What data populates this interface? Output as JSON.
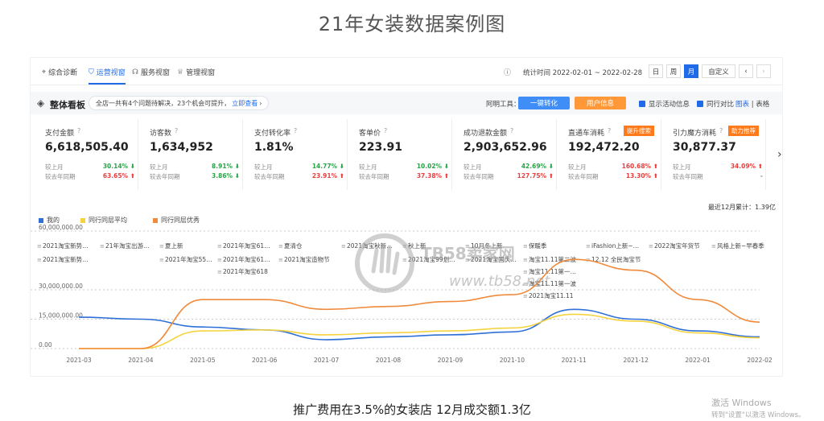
{
  "page_title": "21年女装数据案例图",
  "caption": "推广费用在3.5%的女装店 12月成交额1.3亿",
  "windows_activation": {
    "line1": "激活 Windows",
    "line2": "转到\"设置\"以激活 Windows。"
  },
  "watermark": {
    "text": "TB58卖家网",
    "url": "www.tb58.net"
  },
  "tabs": [
    {
      "label": "综合诊断",
      "icon": "location-icon",
      "active": false
    },
    {
      "label": "运营视窗",
      "icon": "shield-icon",
      "active": true
    },
    {
      "label": "服务视窗",
      "icon": "headset-icon",
      "active": false
    },
    {
      "label": "管理视窗",
      "icon": "trophy-icon",
      "active": false
    }
  ],
  "stat_time": "统计时间 2022-02-01 ~ 2022-02-28",
  "period_buttons": [
    {
      "label": "日",
      "selected": false
    },
    {
      "label": "周",
      "selected": false
    },
    {
      "label": "月",
      "selected": true
    },
    {
      "label": "自定义",
      "selected": false
    }
  ],
  "board": {
    "title": "整体看板",
    "notice": "全店一共有4个问题待解决，23个机会可提升，",
    "notice_link": "立即查看",
    "tool_label": "阿明工具：",
    "btn_convert": "一键转化",
    "btn_user": "用户信息",
    "chk_activity": "显示活动信息",
    "chk_peer": "同行对比",
    "view_chart": "图表",
    "view_table": "表格"
  },
  "kpis": [
    {
      "name": "支付金额",
      "value": "6,618,505.40",
      "r1_label": "较上月",
      "r1_pct": "30.14%",
      "r1_dir": "down",
      "r2_label": "较去年同期",
      "r2_pct": "63.65%",
      "r2_dir": "up",
      "tag": ""
    },
    {
      "name": "访客数",
      "value": "1,634,952",
      "r1_label": "较上月",
      "r1_pct": "8.91%",
      "r1_dir": "down",
      "r2_label": "较去年同期",
      "r2_pct": "3.86%",
      "r2_dir": "down",
      "tag": ""
    },
    {
      "name": "支付转化率",
      "value": "1.81%",
      "r1_label": "较上月",
      "r1_pct": "14.77%",
      "r1_dir": "down",
      "r2_label": "较去年同期",
      "r2_pct": "23.91%",
      "r2_dir": "up",
      "tag": ""
    },
    {
      "name": "客单价",
      "value": "223.91",
      "r1_label": "较上月",
      "r1_pct": "10.02%",
      "r1_dir": "down",
      "r2_label": "较去年同期",
      "r2_pct": "37.38%",
      "r2_dir": "up",
      "tag": ""
    },
    {
      "name": "成功退款金额",
      "value": "2,903,652.96",
      "r1_label": "较上月",
      "r1_pct": "42.69%",
      "r1_dir": "down",
      "r2_label": "较去年同期",
      "r2_pct": "127.75%",
      "r2_dir": "up",
      "tag": ""
    },
    {
      "name": "直通车消耗",
      "value": "192,472.20",
      "r1_label": "较上月",
      "r1_pct": "160.68%",
      "r1_dir": "up",
      "r2_label": "较去年同期",
      "r2_pct": "13.30%",
      "r2_dir": "up",
      "tag": "提升搜索"
    },
    {
      "name": "引力魔方消耗",
      "value": "30,877.37",
      "r1_label": "较上月",
      "r1_pct": "34.09%",
      "r1_dir": "up",
      "r2_label": "较去年同期",
      "r2_pct": "-",
      "r2_dir": "none",
      "tag": "助力推荐"
    }
  ],
  "total_label": "最近12月累计：1.39亿",
  "colors": {
    "mine": "#2f6fd8",
    "peer_avg": "#f5d33f",
    "peer_excellent": "#f08a3c",
    "accent": "#1f6be8"
  },
  "chart_data": {
    "type": "line",
    "x": [
      "2021-03",
      "2021-04",
      "2021-05",
      "2021-06",
      "2021-07",
      "2021-08",
      "2021-09",
      "2021-10",
      "2021-11",
      "2021-12",
      "2022-01",
      "2022-02"
    ],
    "ylim": [
      0,
      60000000
    ],
    "yticks": [
      "0.00",
      "15,000,000.00",
      "30,000,000.00",
      "60,000,000.00"
    ],
    "ytick_values": [
      0,
      15000000,
      30000000,
      60000000
    ],
    "series": [
      {
        "name": "我的",
        "color": "#2f6fd8",
        "values": [
          16000000,
          15000000,
          11000000,
          9500000,
          4500000,
          6000000,
          7000000,
          8500000,
          20000000,
          15000000,
          9000000,
          6000000
        ]
      },
      {
        "name": "同行同层平均",
        "color": "#f5d33f",
        "values": [
          0,
          0,
          9000000,
          9500000,
          7000000,
          8000000,
          9000000,
          10500000,
          17500000,
          14000000,
          8000000,
          5500000
        ]
      },
      {
        "name": "同行同层优秀",
        "color": "#f08a3c",
        "values": [
          0,
          0,
          25000000,
          25000000,
          20000000,
          21500000,
          24000000,
          27500000,
          45500000,
          40000000,
          25000000,
          13500000
        ]
      }
    ],
    "annotations": [
      "2021淘宝新势…",
      "21年淘宝出游…",
      "夏上新",
      "2021年淘宝61…",
      "夏清仓",
      "2021淘宝秋新…",
      "秋上新",
      "10月冬上新",
      "保暖季",
      "iFashion上新~…",
      "2022淘宝年货节",
      "风格上新~早春季",
      "2021淘宝新势…",
      "2021年淘宝55…",
      "2021年淘宝61…",
      "2021淘宝造物节",
      "2021淘宝99划…",
      "2021淘宝国庆…",
      "淘宝11.11第二波",
      "12.12 全民淘宝节",
      "2021年淘宝618",
      "淘宝11.11第一…",
      "淘宝11.11第一波",
      "2021淘宝11.11"
    ]
  }
}
